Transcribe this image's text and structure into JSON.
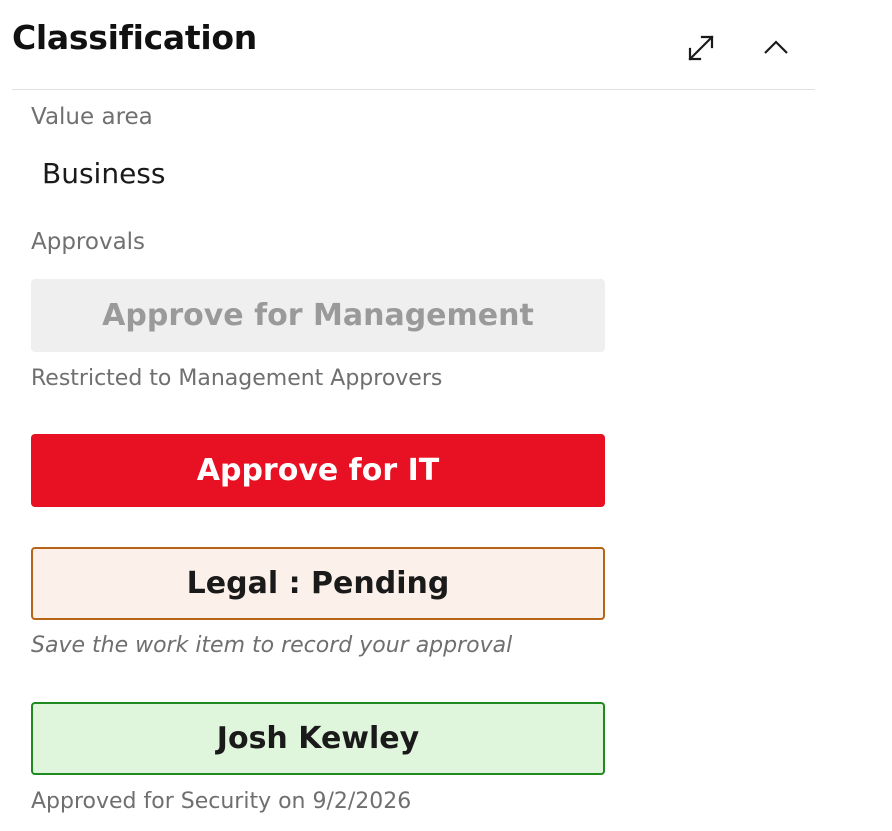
{
  "header": {
    "title": "Classification",
    "expand_icon": "expand-diagonal-icon",
    "collapse_icon": "chevron-up-icon"
  },
  "value_area": {
    "label": "Value area",
    "value": "Business"
  },
  "approvals": {
    "label": "Approvals",
    "management": {
      "button_label": "Approve for Management",
      "note": "Restricted to Management Approvers",
      "state": "disabled"
    },
    "it": {
      "button_label": "Approve for IT",
      "state": "actionable",
      "color": "#e81123"
    },
    "legal": {
      "button_label": "Legal : Pending",
      "note": "Save the work item to record your approval",
      "state": "pending",
      "color": "#b86418"
    },
    "security": {
      "button_label": "Josh Kewley",
      "note": "Approved for Security on 9/2/2026",
      "state": "approved",
      "color": "#1f8a1f"
    }
  }
}
